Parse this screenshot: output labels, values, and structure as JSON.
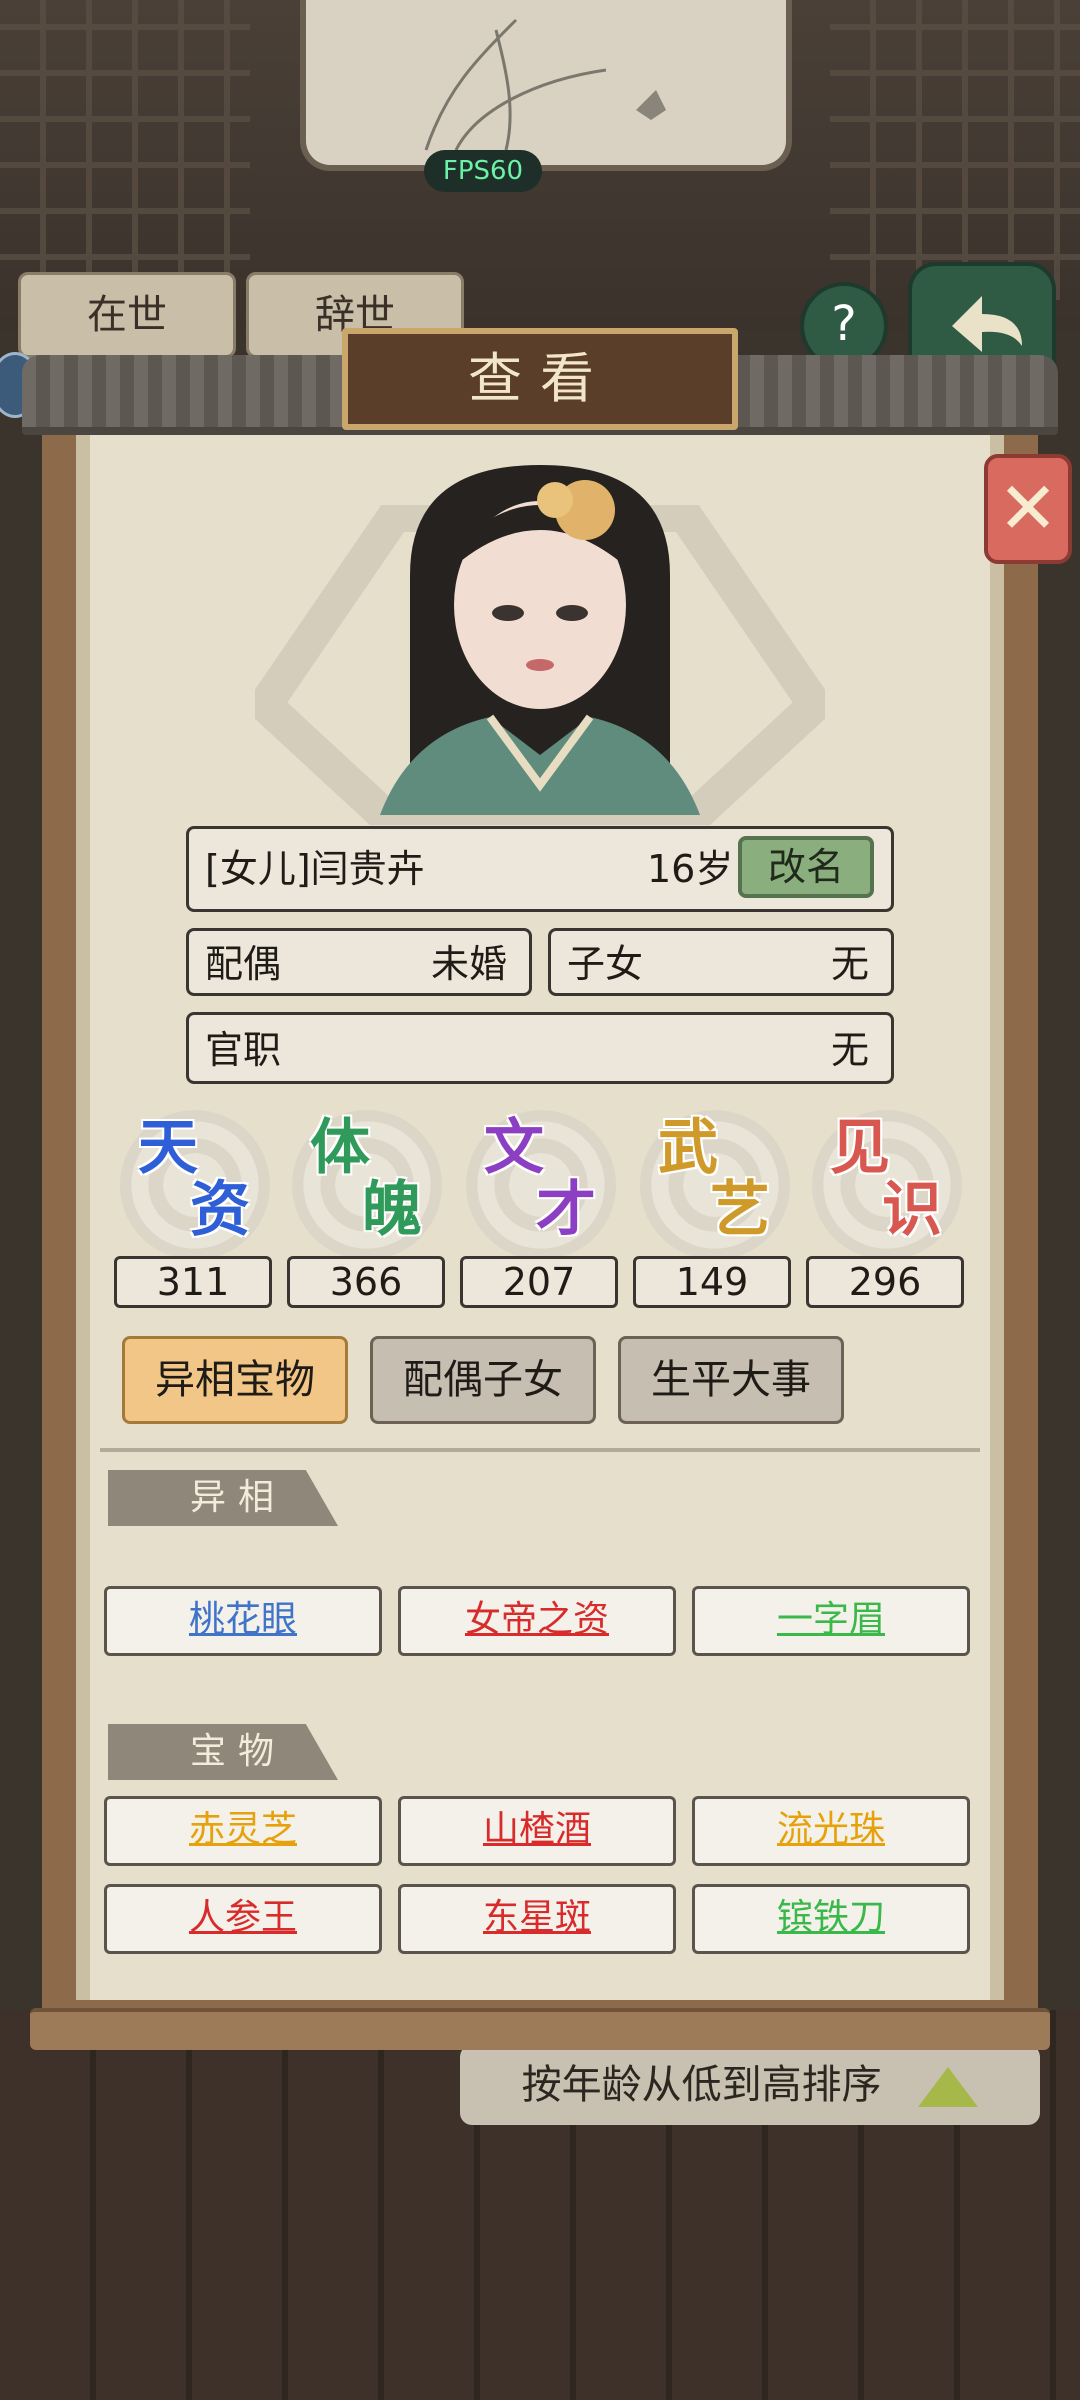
{
  "hud": {
    "fps": "FPS60"
  },
  "background": {
    "tabs": [
      "在世",
      "辞世"
    ],
    "help_icon": "question-icon",
    "back_icon": "back-arrow-icon",
    "sort_label": "按年龄从低到高排序"
  },
  "dialog": {
    "title": "查看",
    "close_icon": "close-x-icon",
    "name_line": "[女儿]闫贵卉",
    "age": "16岁",
    "rename_label": "改名",
    "spouse": {
      "label": "配偶",
      "value": "未婚"
    },
    "children": {
      "label": "子女",
      "value": "无"
    },
    "office": {
      "label": "官职",
      "value": "无"
    },
    "stats": [
      {
        "label": "天资",
        "value": "311",
        "color": "#2e5fd6"
      },
      {
        "label": "体魄",
        "value": "366",
        "color": "#2f9a5a"
      },
      {
        "label": "文才",
        "value": "207",
        "color": "#8c3fc2"
      },
      {
        "label": "武艺",
        "value": "149",
        "color": "#d09a2a"
      },
      {
        "label": "见识",
        "value": "296",
        "color": "#d8574f"
      }
    ],
    "tabs": [
      {
        "label": "异相宝物",
        "active": true
      },
      {
        "label": "配偶子女",
        "active": false
      },
      {
        "label": "生平大事",
        "active": false
      }
    ],
    "traits": {
      "title": "异相",
      "items": [
        {
          "label": "桃花眼",
          "color": "#3f74c9"
        },
        {
          "label": "女帝之资",
          "color": "#d82c2c"
        },
        {
          "label": "一字眉",
          "color": "#3bb84a"
        }
      ]
    },
    "treasures": {
      "title": "宝物",
      "items": [
        {
          "label": "赤灵芝",
          "color": "#e6a20c"
        },
        {
          "label": "山楂酒",
          "color": "#d82c2c"
        },
        {
          "label": "流光珠",
          "color": "#e6a20c"
        },
        {
          "label": "人参王",
          "color": "#d82c2c"
        },
        {
          "label": "东星斑",
          "color": "#d82c2c"
        },
        {
          "label": "镔铁刀",
          "color": "#3bb84a"
        }
      ]
    }
  }
}
